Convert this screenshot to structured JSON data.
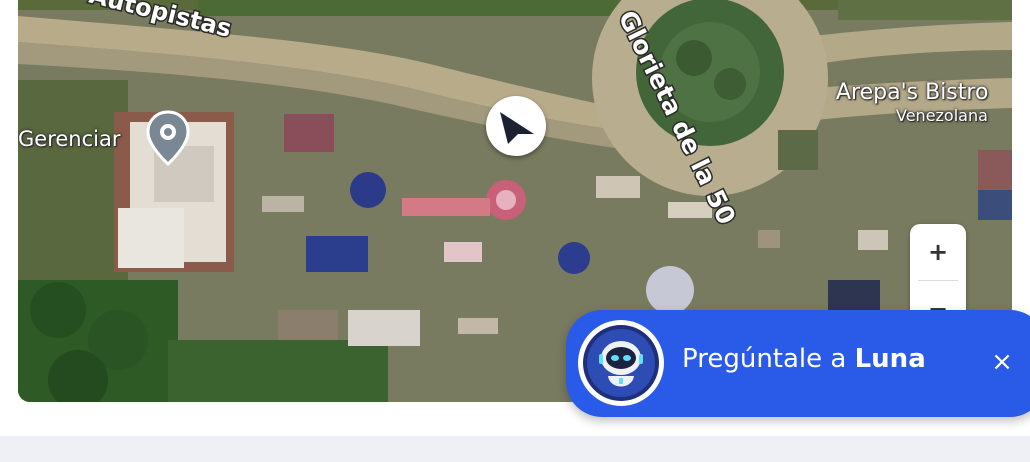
{
  "map": {
    "labels": {
      "top_left_road": "Autopistas",
      "poi_gerenciar": "Gerenciar",
      "roundabout": "Glorieta de la 50",
      "poi_arepas": "Arepa's Bistro",
      "poi_arepas_category": "Venezolana"
    },
    "icons": {
      "poi_pin": "map-pin-icon",
      "user_location": "navigation-arrow-icon"
    }
  },
  "zoom_controls": {
    "zoom_in_label": "+",
    "zoom_out_label": "−"
  },
  "assistant_widget": {
    "prefix": "Pregúntale a ",
    "name": "Luna",
    "close_label": "×",
    "avatar": "robot-avatar-icon",
    "background_color": "#2a5ae8"
  }
}
